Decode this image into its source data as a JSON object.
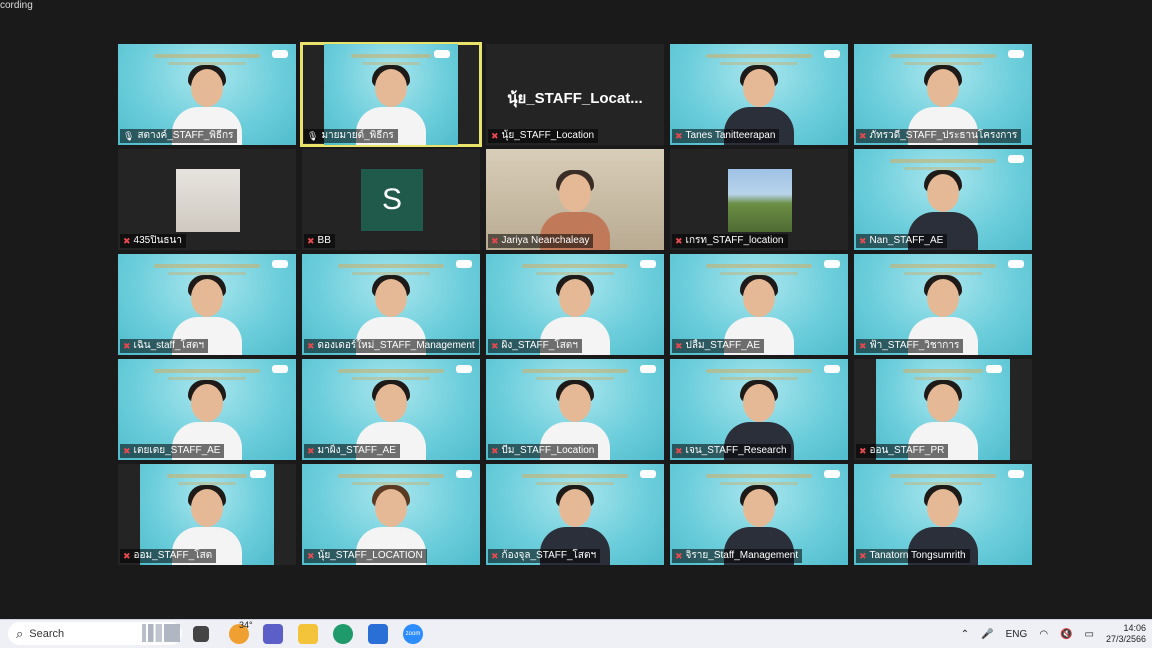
{
  "recording_label": "cording",
  "centered_name_tile": "นุ้ย_STAFF_Locat...",
  "avatar_letter": "S",
  "participants": [
    {
      "name": "สตางค์_STAFF_พิธีกร",
      "mic": "on"
    },
    {
      "name": "มายมายด์_พิธีกร",
      "mic": "on",
      "active": true
    },
    {
      "name": "นุ้ย_STAFF_Location",
      "mic": "off"
    },
    {
      "name": "Tanes Tanitteerapan",
      "mic": "off"
    },
    {
      "name": "ภัทรวดี_STAFF_ประธานโครงการ",
      "mic": "off"
    },
    {
      "name": "435ปิ่นธนา",
      "mic": "off"
    },
    {
      "name": "BB",
      "mic": "off"
    },
    {
      "name": "Jariya Neanchaleay",
      "mic": "off"
    },
    {
      "name": "เกรท_STAFF_location",
      "mic": "off"
    },
    {
      "name": "Nan_STAFF_AE",
      "mic": "off"
    },
    {
      "name": "เฉิน_staff_โสตฯ",
      "mic": "off"
    },
    {
      "name": "ดองเดอร์ใหม่_STAFF_Management",
      "mic": "off"
    },
    {
      "name": "ผิง_STAFF_โสตฯ",
      "mic": "off"
    },
    {
      "name": "ปลื้ม_STAFF_AE",
      "mic": "off"
    },
    {
      "name": "ฟ้า_STAFF_วิชาการ",
      "mic": "off"
    },
    {
      "name": "เตยเตย_STAFF_AE",
      "mic": "off"
    },
    {
      "name": "มาผิ้ง_STAFF_AE",
      "mic": "off"
    },
    {
      "name": "บีม_STAFF_Location",
      "mic": "off"
    },
    {
      "name": "เจน_STAFF_Research",
      "mic": "off"
    },
    {
      "name": "ออน_STAFF_PR",
      "mic": "off"
    },
    {
      "name": "ออม_STAFF_โสต",
      "mic": "off"
    },
    {
      "name": "นุ้ย_STAFF_LOCATION",
      "mic": "off"
    },
    {
      "name": "ก้องจุล_STAFF_โสตฯ",
      "mic": "off"
    },
    {
      "name": "จิราย_Staff_Management",
      "mic": "off"
    },
    {
      "name": "Tanatorn Tongsumrith",
      "mic": "off"
    }
  ],
  "taskbar": {
    "search_placeholder": "Search",
    "weather_temp": "34°",
    "language": "ENG",
    "time": "14:06",
    "date": "27/3/2566"
  },
  "colors": {
    "mic_muted": "#e5484d",
    "active_speaker": "#e9e36b"
  }
}
